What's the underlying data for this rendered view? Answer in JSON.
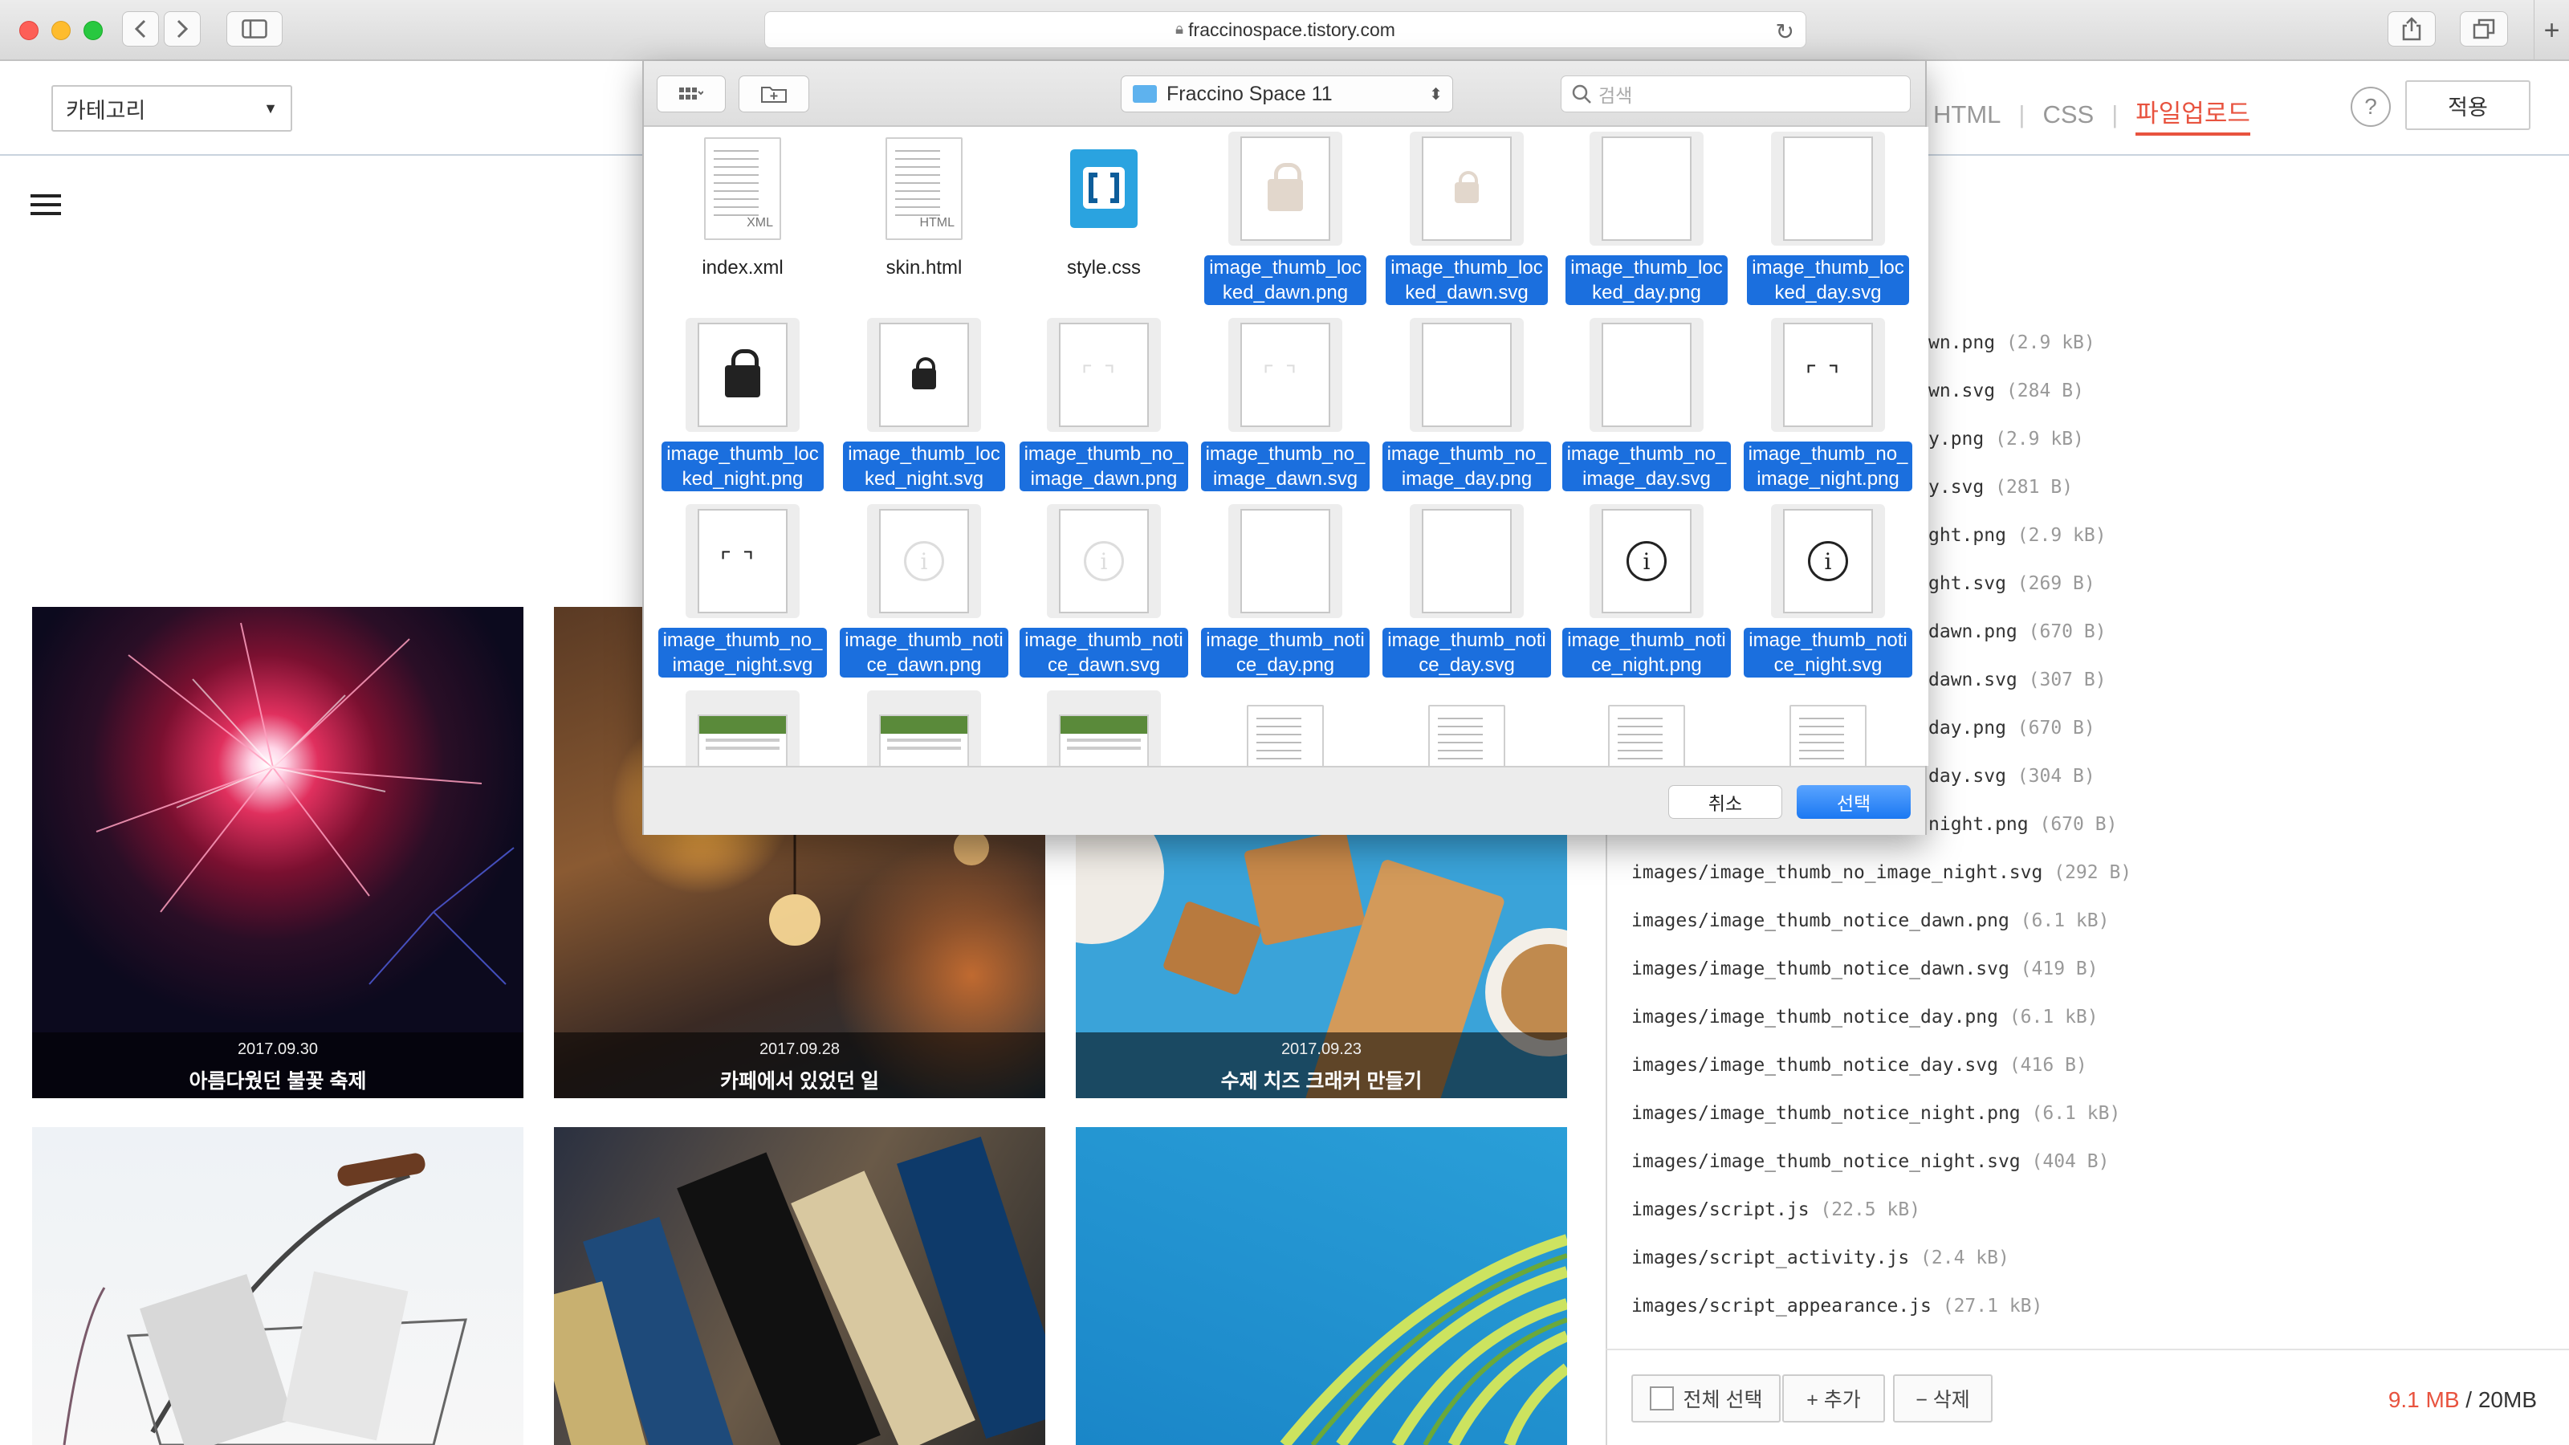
{
  "browser": {
    "url": "fraccinospace.tistory.com"
  },
  "editor": {
    "category_label": "카테고리",
    "tabs": {
      "html": "HTML",
      "css": "CSS",
      "upload": "파일업로드"
    },
    "help": "?",
    "apply": "적용"
  },
  "gallery": [
    {
      "date": "2017.09.30",
      "title": "아름다웠던 불꽃 축제"
    },
    {
      "date": "2017.09.28",
      "title": "카페에서 있었던 일"
    },
    {
      "date": "2017.09.23",
      "title": "수제 치즈 크래커 만들기"
    }
  ],
  "file_list": [
    {
      "name": "wn.png",
      "size": "(2.9 kB)"
    },
    {
      "name": "wn.svg",
      "size": "(284 B)"
    },
    {
      "name": "y.png",
      "size": "(2.9 kB)"
    },
    {
      "name": "y.svg",
      "size": "(281 B)"
    },
    {
      "name": "ght.png",
      "size": "(2.9 kB)"
    },
    {
      "name": "ght.svg",
      "size": "(269 B)"
    },
    {
      "name": "dawn.png",
      "size": "(670 B)"
    },
    {
      "name": "dawn.svg",
      "size": "(307 B)"
    },
    {
      "name": "day.png",
      "size": "(670 B)"
    },
    {
      "name": "day.svg",
      "size": "(304 B)"
    },
    {
      "name": "night.png",
      "size": "(670 B)"
    },
    {
      "name": "images/image_thumb_no_image_night.svg",
      "size": "(292 B)"
    },
    {
      "name": "images/image_thumb_notice_dawn.png",
      "size": "(6.1 kB)"
    },
    {
      "name": "images/image_thumb_notice_dawn.svg",
      "size": "(419 B)"
    },
    {
      "name": "images/image_thumb_notice_day.png",
      "size": "(6.1 kB)"
    },
    {
      "name": "images/image_thumb_notice_day.svg",
      "size": "(416 B)"
    },
    {
      "name": "images/image_thumb_notice_night.png",
      "size": "(6.1 kB)"
    },
    {
      "name": "images/image_thumb_notice_night.svg",
      "size": "(404 B)"
    },
    {
      "name": "images/script.js",
      "size": "(22.5 kB)"
    },
    {
      "name": "images/script_activity.js",
      "size": "(2.4 kB)"
    },
    {
      "name": "images/script_appearance.js",
      "size": "(27.1 kB)"
    }
  ],
  "footer": {
    "select_all": "전체 선택",
    "add": "+ 추가",
    "delete": "− 삭제",
    "used": "9.1 MB",
    "total": "/ 20MB"
  },
  "dialog": {
    "folder": "Fraccino Space 11",
    "search_placeholder": "검색",
    "cancel": "취소",
    "choose": "선택",
    "files": [
      {
        "name1": "index.xml",
        "name2": "",
        "icon": "xml-document-icon",
        "selected": false
      },
      {
        "name1": "skin.html",
        "name2": "",
        "icon": "html-document-icon",
        "selected": false
      },
      {
        "name1": "style.css",
        "name2": "",
        "icon": "css-app-icon",
        "selected": false
      },
      {
        "name1": "image_thumb_loc",
        "name2": "ked_dawn.png",
        "icon": "lock-icon",
        "selected": true
      },
      {
        "name1": "image_thumb_loc",
        "name2": "ked_dawn.svg",
        "icon": "lock-icon",
        "selected": true
      },
      {
        "name1": "image_thumb_loc",
        "name2": "ked_day.png",
        "icon": "blank-image-icon",
        "selected": true
      },
      {
        "name1": "image_thumb_loc",
        "name2": "ked_day.svg",
        "icon": "blank-image-icon",
        "selected": true
      },
      {
        "name1": "image_thumb_loc",
        "name2": "ked_night.png",
        "icon": "lock-icon",
        "selected": true
      },
      {
        "name1": "image_thumb_loc",
        "name2": "ked_night.svg",
        "icon": "lock-icon",
        "selected": true
      },
      {
        "name1": "image_thumb_no_",
        "name2": "image_dawn.png",
        "icon": "frame-icon",
        "selected": true
      },
      {
        "name1": "image_thumb_no_",
        "name2": "image_dawn.svg",
        "icon": "frame-icon",
        "selected": true
      },
      {
        "name1": "image_thumb_no_",
        "name2": "image_day.png",
        "icon": "blank-image-icon",
        "selected": true
      },
      {
        "name1": "image_thumb_no_",
        "name2": "image_day.svg",
        "icon": "blank-image-icon",
        "selected": true
      },
      {
        "name1": "image_thumb_no_",
        "name2": "image_night.png",
        "icon": "frame-icon",
        "selected": true
      },
      {
        "name1": "image_thumb_no_",
        "name2": "image_night.svg",
        "icon": "frame-icon",
        "selected": true
      },
      {
        "name1": "image_thumb_noti",
        "name2": "ce_dawn.png",
        "icon": "info-icon",
        "selected": true
      },
      {
        "name1": "image_thumb_noti",
        "name2": "ce_dawn.svg",
        "icon": "info-icon",
        "selected": true
      },
      {
        "name1": "image_thumb_noti",
        "name2": "ce_day.png",
        "icon": "blank-image-icon",
        "selected": true
      },
      {
        "name1": "image_thumb_noti",
        "name2": "ce_day.svg",
        "icon": "blank-image-icon",
        "selected": true
      },
      {
        "name1": "image_thumb_noti",
        "name2": "ce_night.png",
        "icon": "info-icon",
        "selected": true
      },
      {
        "name1": "image_thumb_noti",
        "name2": "ce_night.svg",
        "icon": "info-icon",
        "selected": true
      }
    ]
  }
}
